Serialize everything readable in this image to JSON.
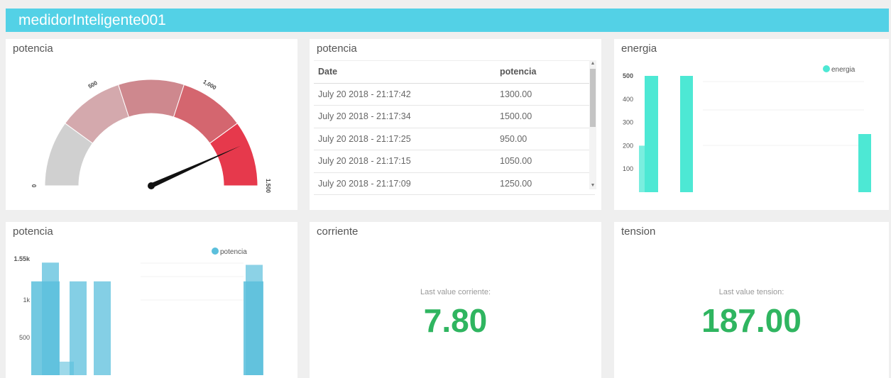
{
  "header": {
    "title": "medidorInteligente001"
  },
  "gauge_panel": {
    "title": "potencia",
    "ticks": [
      "0",
      "500",
      "1,000",
      "1.500"
    ],
    "value_fraction": 0.866,
    "colors": [
      "#d0d0d0",
      "#d4a9ad",
      "#ce888e",
      "#d4666f",
      "#e6394c"
    ]
  },
  "table_panel": {
    "title": "potencia",
    "columns": [
      "Date",
      "potencia"
    ],
    "rows": [
      [
        "July 20 2018 - 21:17:42",
        "1300.00"
      ],
      [
        "July 20 2018 - 21:17:34",
        "1500.00"
      ],
      [
        "July 20 2018 - 21:17:25",
        "950.00"
      ],
      [
        "July 20 2018 - 21:17:15",
        "1050.00"
      ],
      [
        "July 20 2018 - 21:17:09",
        "1250.00"
      ]
    ]
  },
  "energia_panel": {
    "title": "energia",
    "legend": "energia",
    "color": "#4de8d4"
  },
  "potencia_bar_panel": {
    "title": "potencia",
    "legend": "potencia",
    "color": "#5bbfdc"
  },
  "corriente_panel": {
    "title": "corriente",
    "label": "Last value corriente:",
    "value": "7.80"
  },
  "tension_panel": {
    "title": "tension",
    "label": "Last value tension:",
    "value": "187.00"
  },
  "chart_data": [
    {
      "type": "bar",
      "title": "energia",
      "series": [
        {
          "name": "energia",
          "values": [
            200,
            500,
            500,
            250
          ]
        }
      ],
      "yticks": [
        100,
        200,
        300,
        400,
        500
      ],
      "ylim": [
        0,
        500
      ]
    },
    {
      "type": "bar",
      "title": "potencia",
      "series": [
        {
          "name": "potencia",
          "values": [
            1250,
            1500,
            180,
            1250,
            1250,
            1250,
            1470
          ]
        }
      ],
      "yticks": [
        "500",
        "1k",
        "1.55k"
      ],
      "ylim": [
        0,
        1550
      ]
    }
  ]
}
